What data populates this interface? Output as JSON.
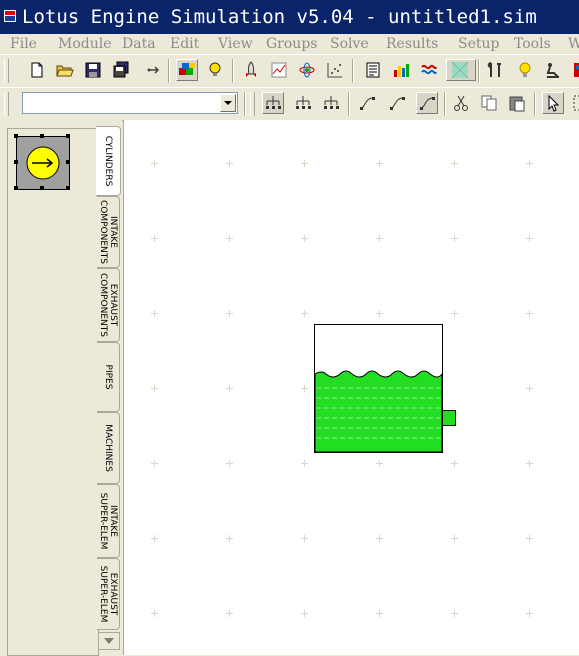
{
  "window": {
    "title": "Lotus Engine Simulation v5.04 - untitled1.sim",
    "icon": "lotus-app-icon"
  },
  "menu": {
    "items": [
      "File",
      "Module",
      "Data",
      "Edit",
      "View",
      "Groups",
      "Solve",
      "Results",
      "Setup",
      "Tools",
      "W"
    ]
  },
  "toolbar1": {
    "buttons": [
      {
        "name": "new-file-icon"
      },
      {
        "name": "open-folder-icon"
      },
      {
        "name": "save-icon"
      },
      {
        "name": "save-all-icon"
      },
      {
        "name": "arrow-tool-icon"
      },
      {
        "name": "cube-model-icon",
        "pressed": true
      },
      {
        "name": "bulb-badge-icon"
      },
      {
        "name": "rocket-icon"
      },
      {
        "name": "graph-grid-icon"
      },
      {
        "name": "atom-icon"
      },
      {
        "name": "scatter-plot-icon"
      },
      {
        "name": "report-icon"
      },
      {
        "name": "bar-chart-icon"
      },
      {
        "name": "wave-plot-icon"
      },
      {
        "name": "gradient-icon",
        "pressed": true
      },
      {
        "name": "tools-icon"
      },
      {
        "name": "lightbulb-icon"
      },
      {
        "name": "machine-icon"
      },
      {
        "name": "book-icon"
      }
    ]
  },
  "toolbar2": {
    "combo_value": "",
    "buttons": [
      {
        "name": "tree-down-icon",
        "pressed": true
      },
      {
        "name": "tree-flat-icon"
      },
      {
        "name": "tree-up-icon"
      },
      {
        "name": "link-curve-icon"
      },
      {
        "name": "link-curve-alt-icon"
      },
      {
        "name": "link-curve-pressed-icon",
        "pressed": true
      },
      {
        "name": "cut-icon"
      },
      {
        "name": "copy-icon"
      },
      {
        "name": "paste-icon"
      },
      {
        "name": "pointer-icon",
        "pressed": true
      },
      {
        "name": "select-box-icon"
      }
    ]
  },
  "palette": {
    "tabs": [
      {
        "label": "CYLINDERS",
        "active": true
      },
      {
        "label": "INTAKE\nCOMPONENTS"
      },
      {
        "label": "EXHAUST\nCOMPONENTS"
      },
      {
        "label": "PIPES"
      },
      {
        "label": "MACHINES"
      },
      {
        "label": "INTAKE\nSUPER-ELEM"
      },
      {
        "label": "EXHAUST\nSUPER-ELEM"
      }
    ],
    "selected_component": "cylinder-icon"
  },
  "canvas": {
    "component": "plenum-tank",
    "colors": {
      "fluid": "#22dd22",
      "grid": "#d8d8c8"
    }
  }
}
